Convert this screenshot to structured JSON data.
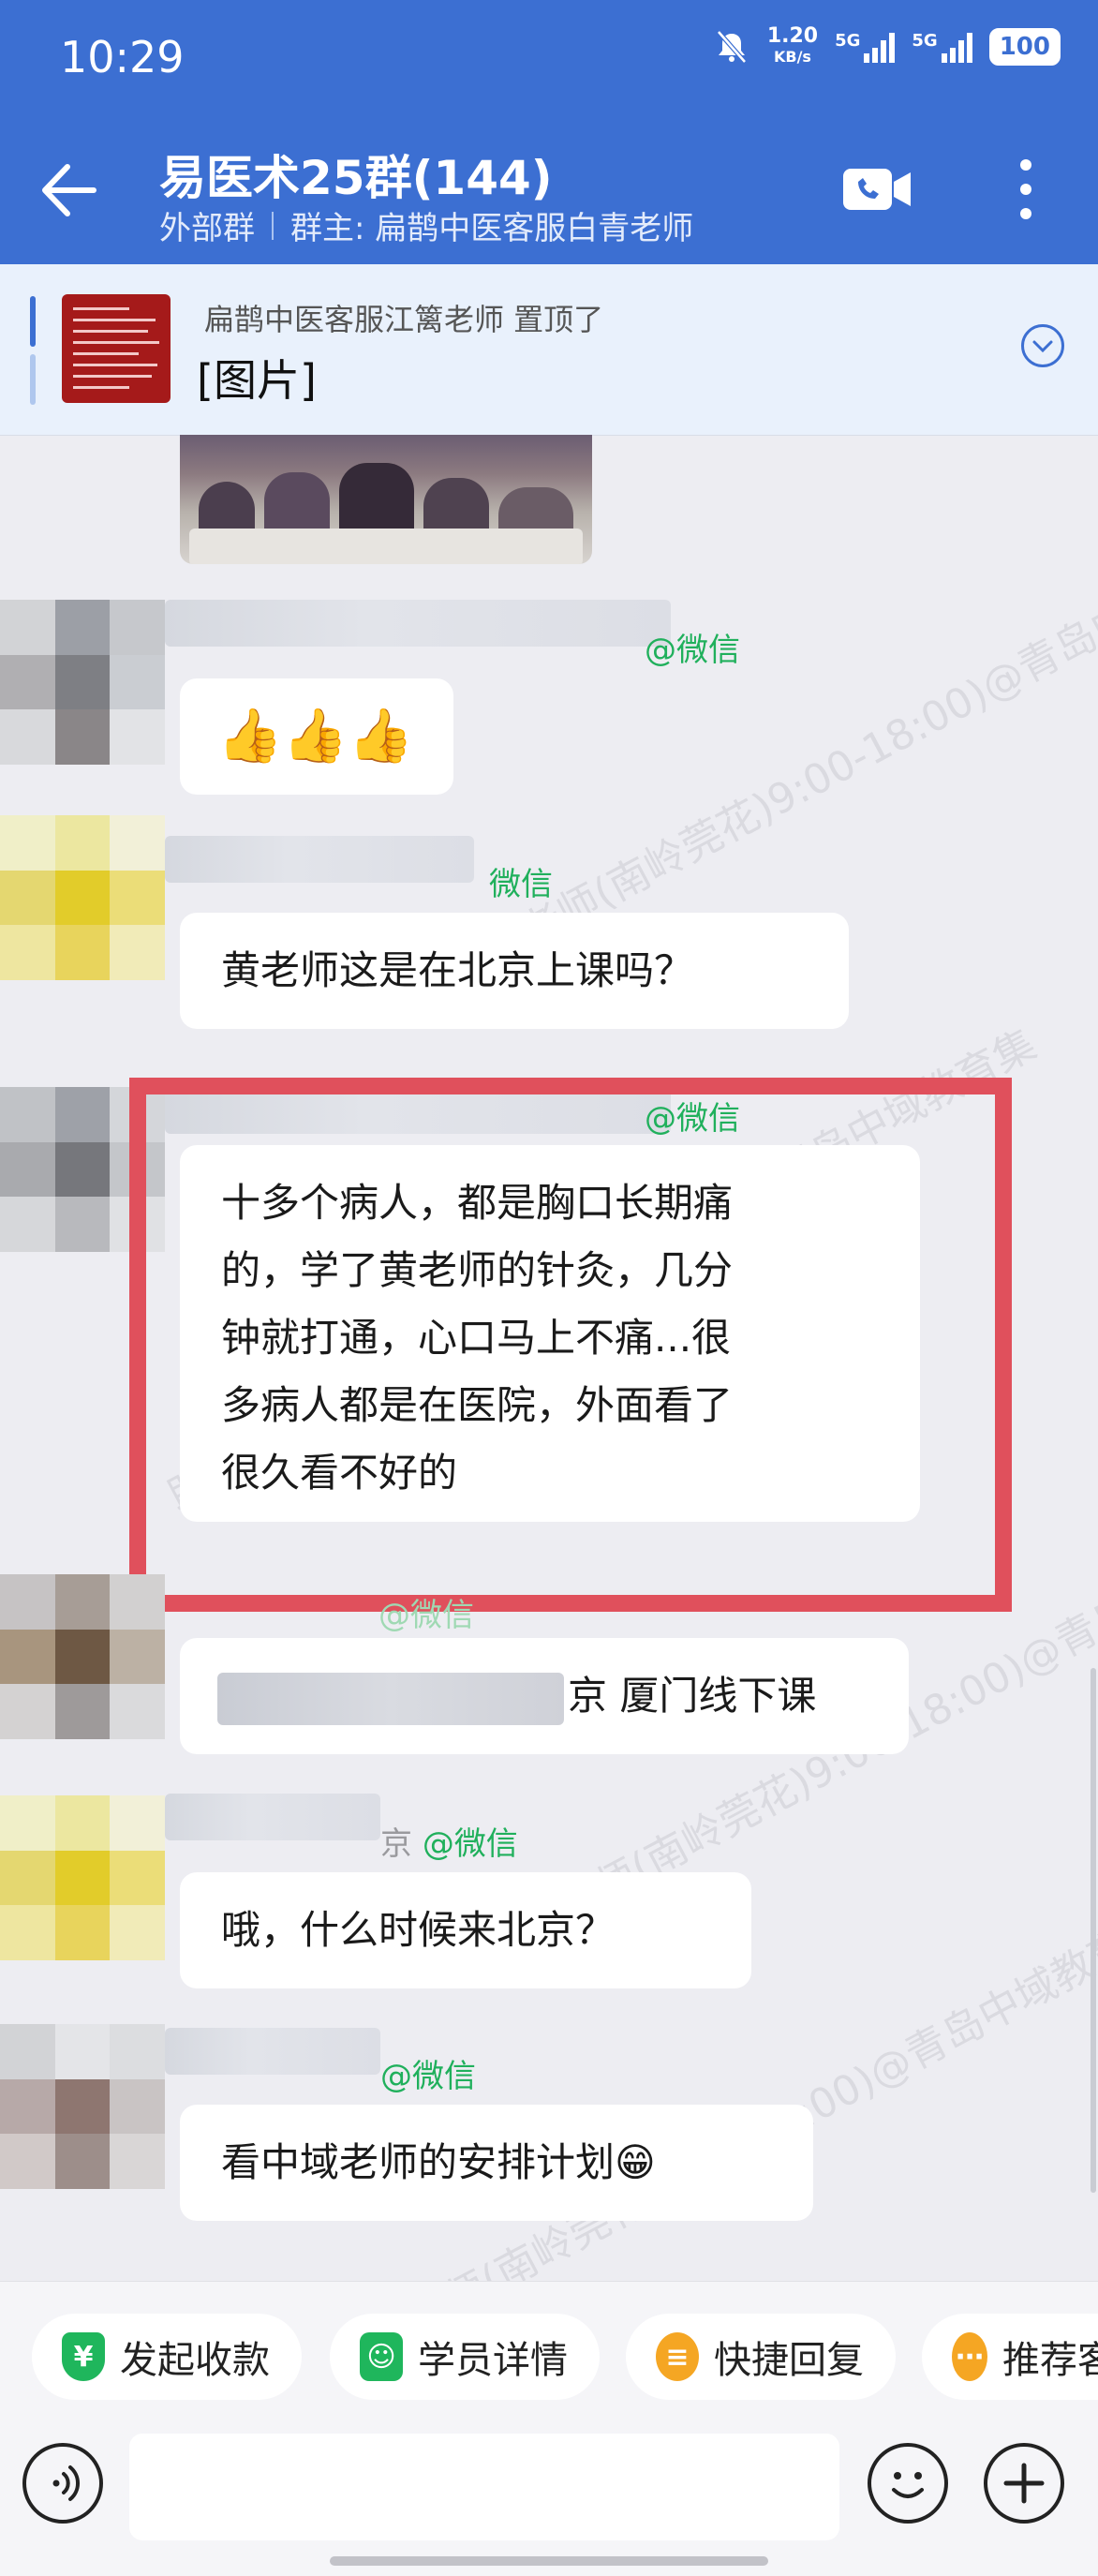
{
  "status_bar": {
    "time": "10:29",
    "net_speed_value": "1.20",
    "net_speed_unit": "KB/s",
    "signal1_label": "5G",
    "signal2_label": "5G",
    "battery": "100"
  },
  "header": {
    "title": "易医术25群(144)",
    "tag": "外部群",
    "owner": "群主: 扁鹊中医客服白青老师"
  },
  "pinned": {
    "sender_action": "扁鹊中医客服江篱老师 置顶了",
    "content": "[图片]"
  },
  "messages": [
    {
      "sender_suffix": "@微信",
      "type": "emoji",
      "text": "👍👍👍"
    },
    {
      "sender_suffix": "微信",
      "type": "text",
      "text": "黄老师这是在北京上课吗？"
    },
    {
      "sender_suffix": "@微信",
      "type": "text",
      "lines": [
        "十多个病人，都是胸口长期痛",
        "的，学了黄老师的针灸，几分",
        "钟就打通，心口马上不痛...很",
        "多病人都是在医院，外面看了",
        "很久看不好的"
      ]
    },
    {
      "sender_suffix": "@微信",
      "type": "text",
      "text": "京 厦门线下课"
    },
    {
      "sender_prefix": "京",
      "sender_suffix": "@微信",
      "type": "text",
      "text": "哦，什么时候来北京？"
    },
    {
      "sender_suffix": "@微信",
      "type": "text",
      "text": "看中域老师的安排计划😁"
    }
  ],
  "watermark_text": "助理赵老师(南岭莞花)9:00-18:00)@青岛中域教育集",
  "quick_actions": [
    {
      "label": "发起收款",
      "icon": "yen-icon",
      "color": "#1FB65C"
    },
    {
      "label": "学员详情",
      "icon": "person-card-icon",
      "color": "#1FB65C"
    },
    {
      "label": "快捷回复",
      "icon": "quick-reply-icon",
      "color": "#F5A623"
    },
    {
      "label": "推荐客",
      "icon": "recommend-icon",
      "color": "#F5A623"
    }
  ],
  "colors": {
    "header_bg": "#3C6FD2",
    "highlight_border": "#E0505C",
    "wechat_green": "#20B05C"
  }
}
